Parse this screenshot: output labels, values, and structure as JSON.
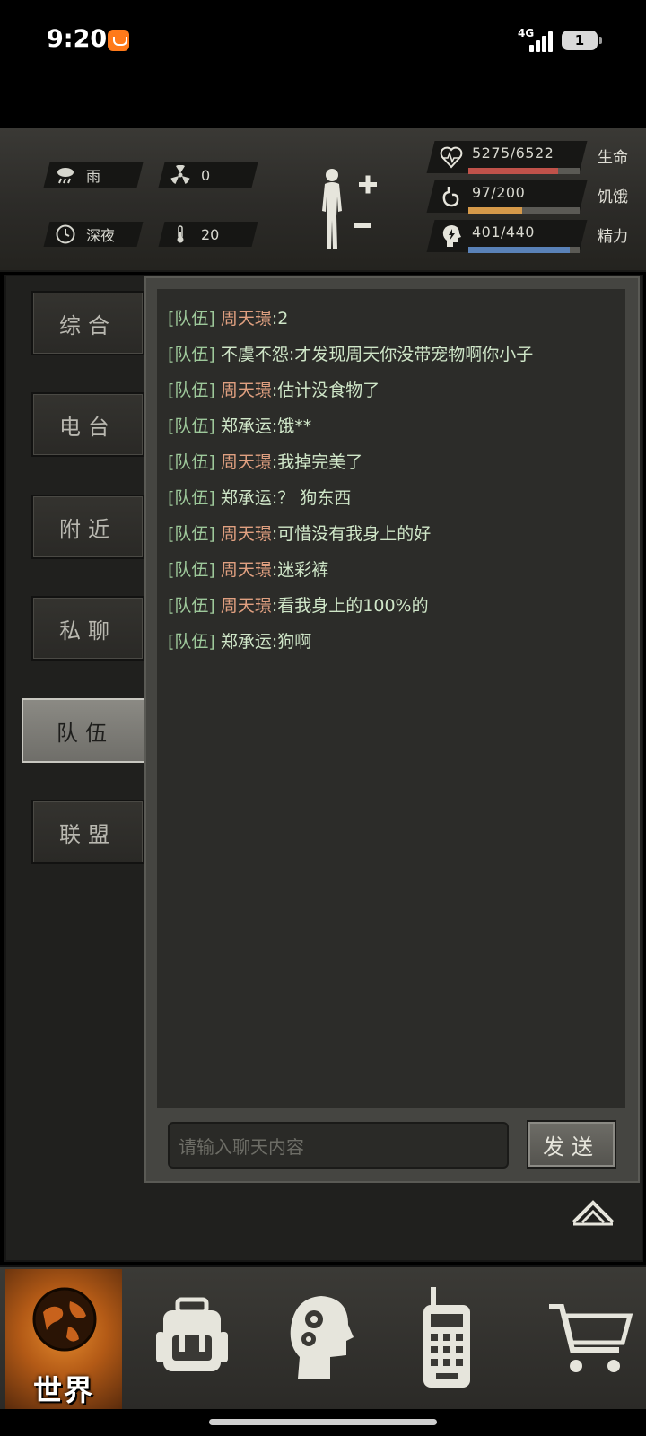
{
  "status_bar": {
    "time": "9:20",
    "network": "4G",
    "battery": "1"
  },
  "hud": {
    "weather": "雨",
    "radiation": "0",
    "time_of_day": "深夜",
    "temperature": "20",
    "stats": [
      {
        "label": "生命",
        "value": "5275/6522",
        "fraction": 0.809,
        "color": "#c0524a"
      },
      {
        "label": "饥饿",
        "value": "97/200",
        "fraction": 0.485,
        "color": "#d69a4a"
      },
      {
        "label": "精力",
        "value": "401/440",
        "fraction": 0.911,
        "color": "#5a82b8"
      }
    ]
  },
  "tabs": [
    {
      "label": "综合"
    },
    {
      "label": "电台"
    },
    {
      "label": "附近"
    },
    {
      "label": "私聊"
    },
    {
      "label": "队伍",
      "active": true
    },
    {
      "label": "联盟"
    }
  ],
  "chat": {
    "messages": [
      {
        "channel": "[队伍]",
        "name": "周天璟",
        "text": ":2",
        "self": true
      },
      {
        "channel": "[队伍]",
        "name": "不虞不怨",
        "text": ":才发现周天你没带宠物啊你小子",
        "self": false
      },
      {
        "channel": "[队伍]",
        "name": "周天璟",
        "text": ":估计没食物了",
        "self": true
      },
      {
        "channel": "[队伍]",
        "name": "郑承运",
        "text": ":饿**",
        "self": false
      },
      {
        "channel": "[队伍]",
        "name": "周天璟",
        "text": ":我掉完美了",
        "self": true
      },
      {
        "channel": "[队伍]",
        "name": "郑承运",
        "text": ":？ 狗东西",
        "self": false
      },
      {
        "channel": "[队伍]",
        "name": "周天璟",
        "text": ":可惜没有我身上的好",
        "self": true
      },
      {
        "channel": "[队伍]",
        "name": "周天璟",
        "text": ":迷彩裤",
        "self": true
      },
      {
        "channel": "[队伍]",
        "name": "周天璟",
        "text": ":看我身上的100%的",
        "self": true
      },
      {
        "channel": "[队伍]",
        "name": "郑承运",
        "text": ":狗啊",
        "self": false
      }
    ],
    "input_placeholder": "请输入聊天内容",
    "send_label": "发送"
  },
  "bottom_nav": {
    "world_label": "世界",
    "items": [
      "world-icon",
      "backpack-icon",
      "skills-head-icon",
      "radio-icon",
      "cart-icon"
    ]
  }
}
